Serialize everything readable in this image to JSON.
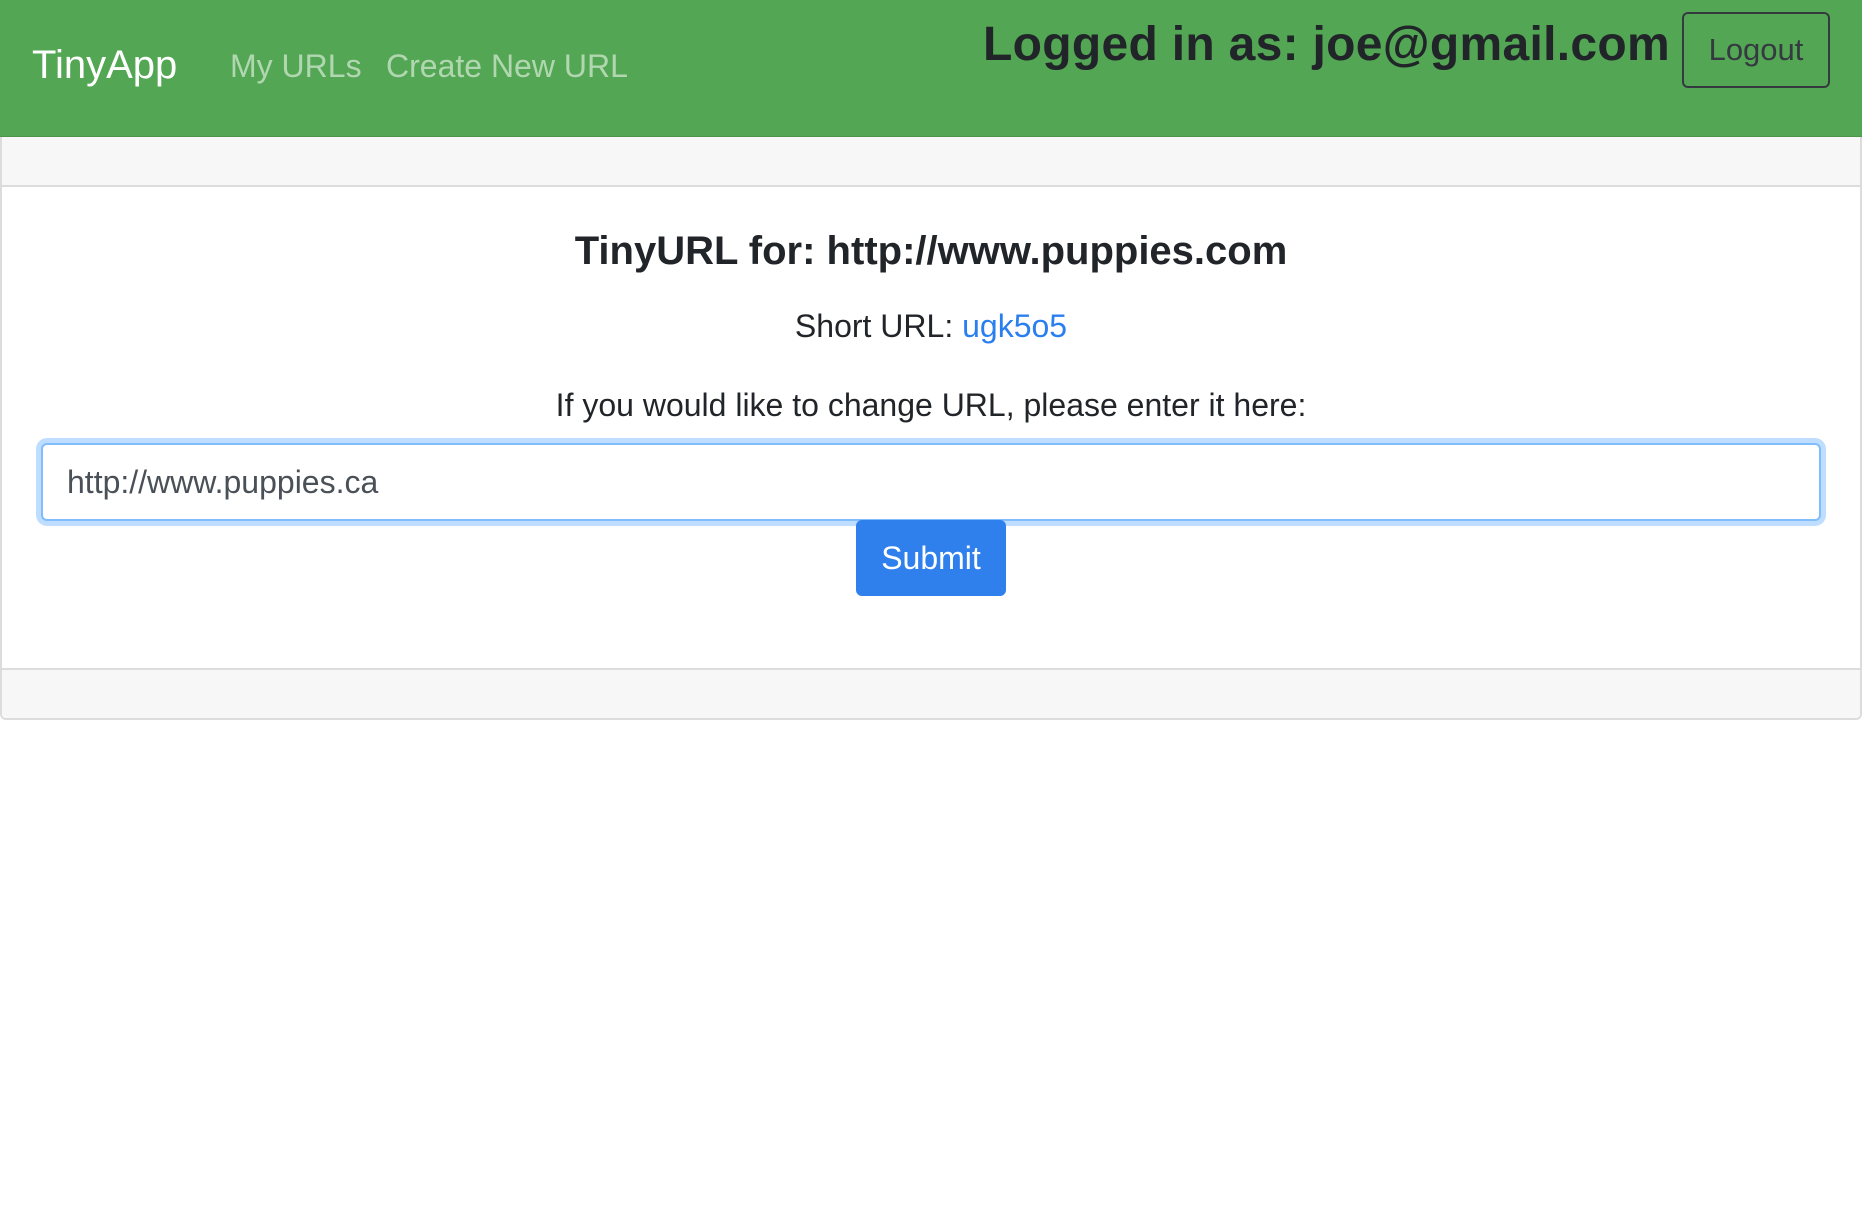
{
  "navbar": {
    "brand": "TinyApp",
    "links": [
      {
        "label": "My URLs"
      },
      {
        "label": "Create New URL"
      }
    ],
    "login_status": "Logged in as: joe@gmail.com",
    "logout_label": "Logout"
  },
  "card": {
    "title": "TinyURL for: http://www.puppies.com",
    "short_url_label": "Short URL: ",
    "short_url_value": "ugk5o5",
    "change_label": "If you would like to change URL, please enter it here:",
    "input_value": "http://www.puppies.ca",
    "submit_label": "Submit"
  },
  "colors": {
    "navbar_bg": "#53a653",
    "link_blue": "#2a7ff0",
    "button_blue": "#2f80ed"
  }
}
